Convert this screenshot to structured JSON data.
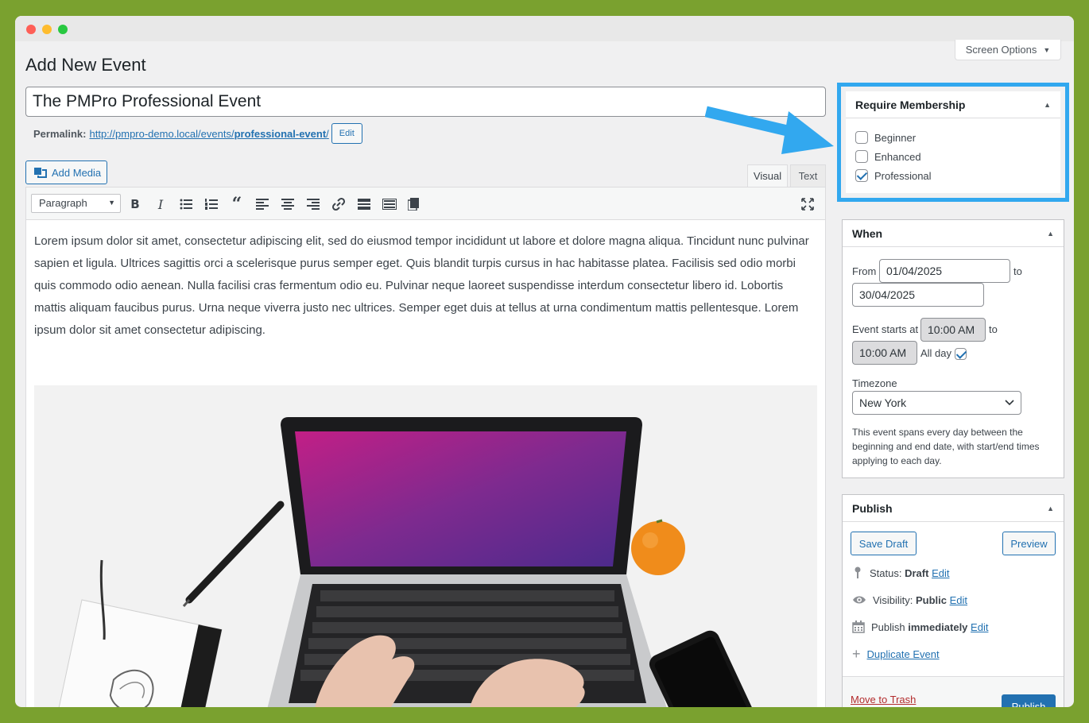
{
  "page": {
    "title": "Add New Event",
    "screen_options": "Screen Options"
  },
  "post": {
    "title": "The PMPro Professional Event",
    "permalink_label": "Permalink:",
    "permalink_base": "http://pmpro-demo.local/events/",
    "permalink_slug": "professional-event",
    "permalink_suffix": "/",
    "edit_label": "Edit"
  },
  "editor": {
    "add_media": "Add Media",
    "tabs": {
      "visual": "Visual",
      "text": "Text"
    },
    "format": "Paragraph",
    "content": "Lorem ipsum dolor sit amet, consectetur adipiscing elit, sed do eiusmod tempor incididunt ut labore et dolore magna aliqua. Tincidunt nunc pulvinar sapien et ligula. Ultrices sagittis orci a scelerisque purus semper eget. Quis blandit turpis cursus in hac habitasse platea. Facilisis sed odio morbi quis commodo odio aenean. Nulla facilisi cras fermentum odio eu. Pulvinar neque laoreet suspendisse interdum consectetur libero id. Lobortis mattis aliquam faucibus purus. Urna neque viverra justo nec ultrices. Semper eget duis at tellus at urna condimentum mattis pellentesque. Lorem ipsum dolor sit amet consectetur adipiscing.",
    "toolbar_icons": [
      "bold-icon",
      "italic-icon",
      "bullet-list-icon",
      "numbered-list-icon",
      "blockquote-icon",
      "align-left-icon",
      "align-center-icon",
      "align-right-icon",
      "link-icon",
      "read-more-icon",
      "toolbar-toggle-icon",
      "paste-icon",
      "fullscreen-icon"
    ]
  },
  "membership": {
    "title": "Require Membership",
    "levels": [
      {
        "label": "Beginner",
        "checked": false
      },
      {
        "label": "Enhanced",
        "checked": false
      },
      {
        "label": "Professional",
        "checked": true
      }
    ],
    "highlight_color": "#32a8ef"
  },
  "when": {
    "title": "When",
    "from_label": "From",
    "from_date": "01/04/2025",
    "to_label": "to",
    "to_date": "30/04/2025",
    "starts_label": "Event starts at",
    "start_time": "10:00 AM",
    "to_label2": "to",
    "end_time": "10:00 AM",
    "all_day_label": "All day",
    "all_day": true,
    "timezone_label": "Timezone",
    "timezone": "New York",
    "note": "This event spans every day between the beginning and end date, with start/end times applying to each day."
  },
  "publish": {
    "title": "Publish",
    "save_draft": "Save Draft",
    "preview": "Preview",
    "status_label": "Status:",
    "status_value": "Draft",
    "visibility_label": "Visibility:",
    "visibility_value": "Public",
    "publish_label": "Publish",
    "publish_value": "immediately",
    "edit": "Edit",
    "duplicate": "Duplicate Event",
    "trash": "Move to Trash",
    "publish_button": "Publish"
  },
  "colors": {
    "accent": "#2271b1",
    "background": "#7aa12f"
  }
}
